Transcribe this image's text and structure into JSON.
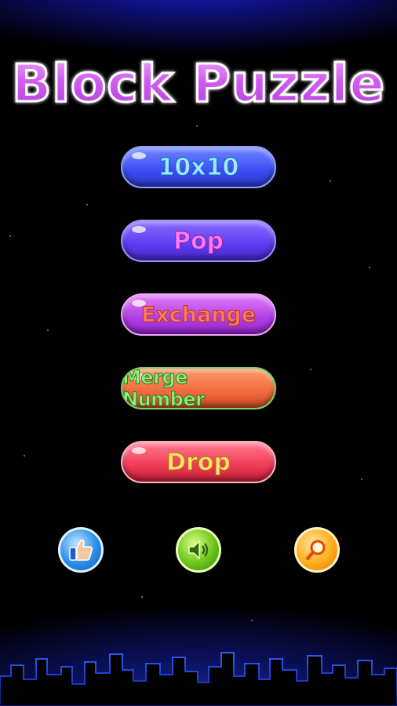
{
  "game": {
    "title": "Block Puzzle"
  },
  "menu": {
    "buttons": [
      {
        "id": "10x10",
        "label": "10x10"
      },
      {
        "id": "pop",
        "label": "Pop"
      },
      {
        "id": "exchange",
        "label": "Exchange"
      },
      {
        "id": "merge",
        "label": "Merge Number"
      },
      {
        "id": "drop",
        "label": "Drop"
      }
    ]
  },
  "bottom_bar": {
    "icons": [
      "thumbs-up-icon",
      "speaker-icon",
      "search-icon"
    ]
  },
  "colors": {
    "background": "#000000",
    "title_fill": "#d564f0",
    "sky_glow": "#1a20c8"
  }
}
